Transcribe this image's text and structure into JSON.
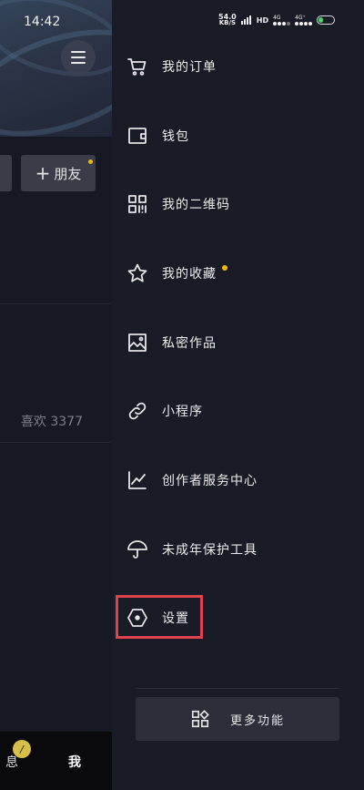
{
  "status_bar": {
    "time": "14:42",
    "net_speed_value": "54.0",
    "net_speed_unit": "KB/S",
    "hd_label": "HD",
    "sig1_label": "4G",
    "sig2_label": "4G⁺"
  },
  "background_page": {
    "add_friend_label": "朋友",
    "likes_text": "喜欢 3377",
    "tab_msg_label": "息",
    "tab_me_label": "我"
  },
  "drawer": {
    "items": [
      {
        "label": "我的订单",
        "icon": "cart-icon"
      },
      {
        "label": "钱包",
        "icon": "wallet-icon"
      },
      {
        "label": "我的二维码",
        "icon": "qr-code-icon"
      },
      {
        "label": "我的收藏",
        "icon": "star-icon",
        "has_dot": true
      },
      {
        "label": "私密作品",
        "icon": "private-image-icon"
      },
      {
        "label": "小程序",
        "icon": "link-icon"
      },
      {
        "label": "创作者服务中心",
        "icon": "chart-line-icon"
      },
      {
        "label": "未成年保护工具",
        "icon": "umbrella-icon"
      },
      {
        "label": "设置",
        "icon": "settings-hexagon-icon",
        "highlighted": true
      }
    ],
    "more_label": "更多功能"
  },
  "colors": {
    "drawer_bg": "#191b26",
    "accent_dot": "#f4b400",
    "highlight": "#e0414b"
  }
}
